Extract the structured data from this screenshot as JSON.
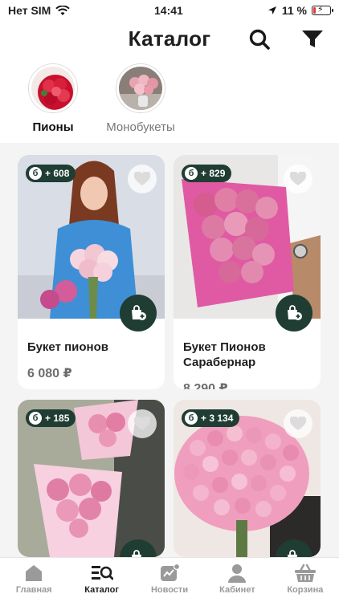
{
  "status_bar": {
    "carrier": "Нет SIM",
    "time": "14:41",
    "battery": "11 %"
  },
  "header": {
    "title": "Каталог",
    "search_icon": "search-icon",
    "filter_icon": "filter-icon"
  },
  "categories": [
    {
      "label": "Пионы",
      "active": true
    },
    {
      "label": "Монобукеты",
      "active": false
    }
  ],
  "products": [
    {
      "bonus": "+ 608",
      "name": "Букет пионов",
      "price": "6 080 ₽"
    },
    {
      "bonus": "+ 829",
      "name": "Букет Пионов Сарабернар",
      "price": "8 290 ₽"
    },
    {
      "bonus": "+ 185",
      "name": "",
      "price": ""
    },
    {
      "bonus": "+ 3 134",
      "name": "",
      "price": ""
    }
  ],
  "badge_letter": "б",
  "tabs": [
    {
      "label": "Главная",
      "icon": "home-icon",
      "active": false
    },
    {
      "label": "Каталог",
      "icon": "catalog-icon",
      "active": true
    },
    {
      "label": "Новости",
      "icon": "news-icon",
      "active": false
    },
    {
      "label": "Кабинет",
      "icon": "profile-icon",
      "active": false
    },
    {
      "label": "Корзина",
      "icon": "basket-icon",
      "active": false
    }
  ],
  "colors": {
    "accent": "#1f3d33",
    "background": "#f4f4f4",
    "price_gray": "#6d6d6d"
  }
}
